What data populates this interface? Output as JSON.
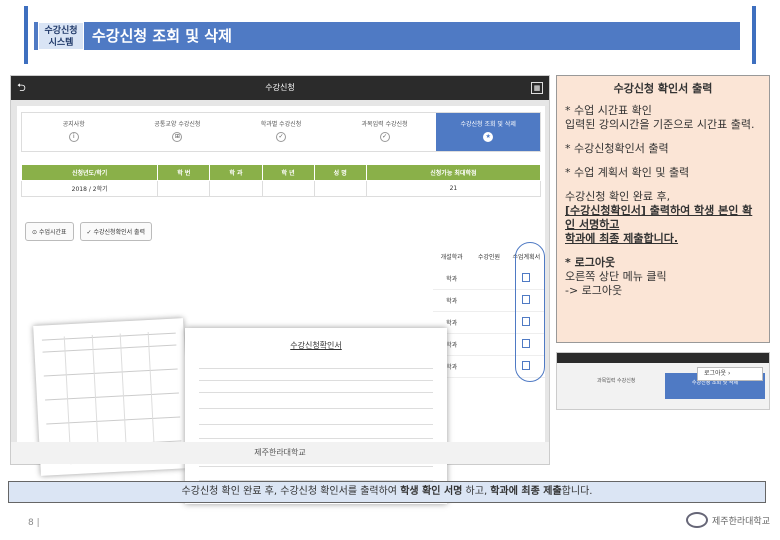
{
  "header": {
    "badge": "수강신청\n시스템",
    "badge1": "수강신청",
    "badge2": "시스템",
    "title": "수강신청 조회 및 삭제"
  },
  "app": {
    "title": "수강신청",
    "back": "⮌",
    "grid": "▦"
  },
  "tabs": [
    {
      "label": "공지사항",
      "icon": "info-icon"
    },
    {
      "label": "공통교양 수강신청",
      "icon": "grid-icon"
    },
    {
      "label": "학과별 수강신청",
      "icon": "check-icon"
    },
    {
      "label": "과목입력 수강신청",
      "icon": "check-icon"
    },
    {
      "label": "수강신청 조회 및 삭제",
      "icon": "star-icon",
      "active": true
    }
  ],
  "info_table": {
    "headers": [
      "신청년도/학기",
      "학 번",
      "학 과",
      "학 년",
      "성 명",
      "신청가능 최대학점"
    ],
    "values": [
      "2018 / 2학기",
      "",
      "",
      "",
      "",
      "21"
    ]
  },
  "buttons": {
    "timetable": "수업시간표",
    "print": "수강신청확인서 출력"
  },
  "side_cols": {
    "dept": "개설학과",
    "count": "수강인원",
    "plan": "수업계획서"
  },
  "rows": [
    "학과",
    "학과",
    "학과",
    "학과",
    "학과"
  ],
  "doc": {
    "title": "수강신청확인서"
  },
  "footer": "제주한라대학교",
  "note": {
    "title": "수강신청 확인서 출력",
    "p1a": "* 수업 시간표 확인",
    "p1b": "입력된 강의시간을 기준으로 시간표 출력.",
    "p2": "* 수강신청확인서 출력",
    "p3": "* 수업 계획서 확인 및 출력",
    "p4a": "수강신청 확인 완료 후,",
    "p4b": "[수강신청확인서] 출력하여 학생 본인 확인 서명하고",
    "p4c": "학과에 최종 제출합니다.",
    "p5a": "* 로그아웃",
    "p5b": "오른쪽 상단 메뉴 클릭",
    "p5c": "-> 로그아웃"
  },
  "mini": {
    "tab1": "과목입력 수강신청",
    "tab2": "수강신청 조회 및 삭제",
    "logout": "로그아웃"
  },
  "summary": {
    "pre": "수강신청 확인 완료 후, 수강신청 확인서를 출력하여 ",
    "b1": "학생 확인 서명",
    "mid": " 하고, ",
    "b2": "학과에 최종 제출",
    "post": "합니다."
  },
  "page": "8 |",
  "logo": "제주한라대학교"
}
